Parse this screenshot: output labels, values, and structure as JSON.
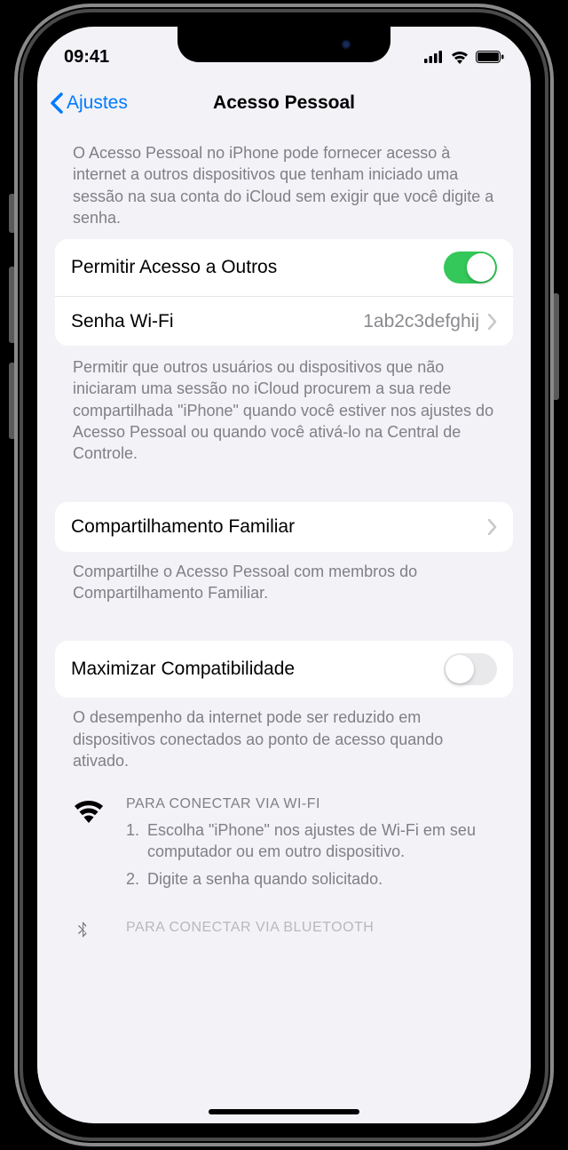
{
  "status": {
    "time": "09:41"
  },
  "nav": {
    "back": "Ajustes",
    "title": "Acesso Pessoal"
  },
  "header1": "O Acesso Pessoal no iPhone pode fornecer acesso à internet a outros dispositivos que tenham iniciado uma sessão na sua conta do iCloud sem exigir que você digite a senha.",
  "rows": {
    "allow": {
      "label": "Permitir Acesso a Outros",
      "on": true
    },
    "wifi_pw": {
      "label": "Senha Wi-Fi",
      "value": "1ab2c3defghij"
    },
    "family": {
      "label": "Compartilhamento Familiar"
    },
    "maxcompat": {
      "label": "Maximizar Compatibilidade",
      "on": false
    }
  },
  "footer_allow": "Permitir que outros usuários ou dispositivos que não iniciaram uma sessão no iCloud procurem a sua rede compartilhada \"iPhone\" quando você estiver nos ajustes do Acesso Pessoal ou quando você ativá-lo na Central de Controle.",
  "footer_family": "Compartilhe o Acesso Pessoal com membros do Compartilhamento Familiar.",
  "footer_maxcompat": "O desempenho da internet pode ser reduzido em dispositivos conectados ao ponto de acesso quando ativado.",
  "wifi_instructions": {
    "title": "PARA CONECTAR VIA WI-FI",
    "steps": [
      "Escolha \"iPhone\" nos ajustes de Wi-Fi em seu computador ou em outro dispositivo.",
      "Digite a senha quando solicitado."
    ]
  },
  "bt_instructions": {
    "title": "PARA CONECTAR VIA BLUETOOTH"
  }
}
